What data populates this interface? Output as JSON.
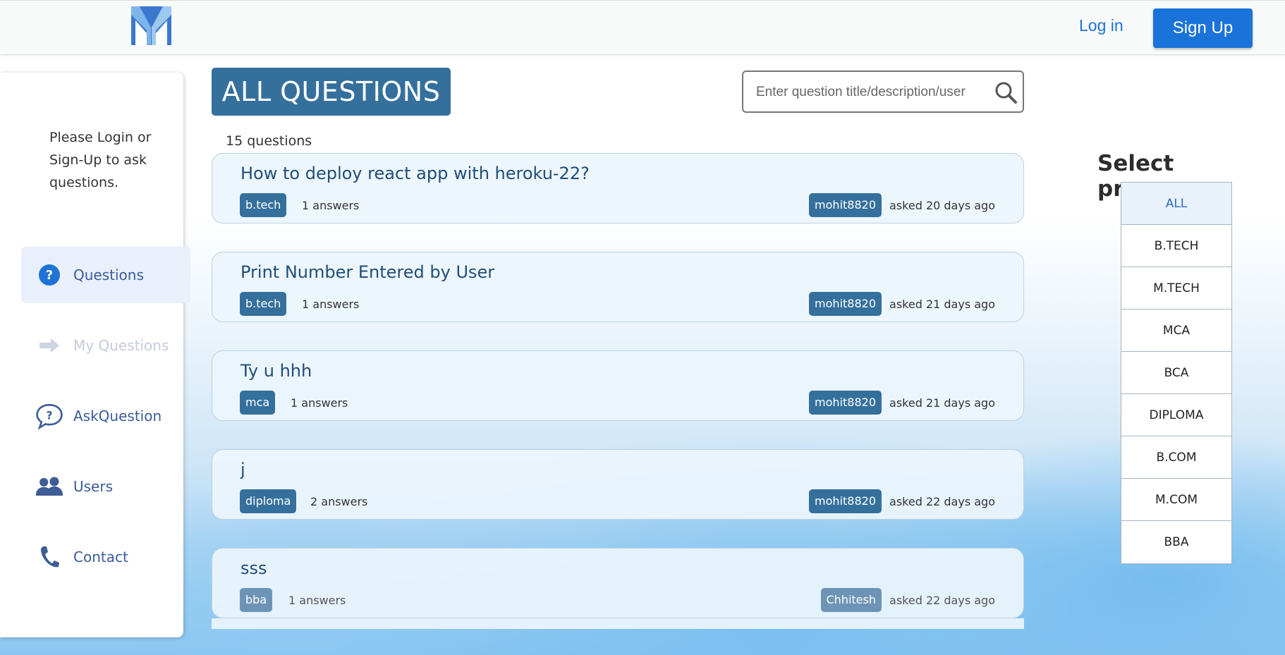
{
  "header": {
    "login_label": "Log in",
    "signup_label": "Sign Up",
    "accent_color": "#1a73d8"
  },
  "sidebar": {
    "message": "Please Login or Sign-Up to ask questions.",
    "items": [
      {
        "label": "Questions",
        "icon": "question-circle-icon",
        "active": true
      },
      {
        "label": "My Questions",
        "icon": "arrow-right-icon",
        "disabled": true
      },
      {
        "label": "AskQuestion",
        "icon": "question-bubble-icon"
      },
      {
        "label": "Users",
        "icon": "users-icon"
      },
      {
        "label": "Contact",
        "icon": "phone-icon"
      }
    ]
  },
  "main": {
    "title": "ALL QUESTIONS",
    "title_color": "#35709d",
    "search_placeholder": "Enter question title/description/user",
    "count_label": "15 questions",
    "questions": [
      {
        "title": "How to deploy react app with heroku-22?",
        "tag": "b.tech",
        "answers": "1 answers",
        "user": "mohit8820",
        "time": "asked 20 days ago"
      },
      {
        "title": "Print Number Entered by User",
        "tag": "b.tech",
        "answers": "1 answers",
        "user": "mohit8820",
        "time": "asked 21 days ago"
      },
      {
        "title": "Ty u hhh",
        "tag": "mca",
        "answers": "1 answers",
        "user": "mohit8820",
        "time": "asked 21 days ago"
      },
      {
        "title": "j",
        "tag": "diploma",
        "answers": "2 answers",
        "user": "mohit8820",
        "time": "asked 22 days ago"
      },
      {
        "title": "sss",
        "tag": "bba",
        "answers": "1 answers",
        "user": "Chhitesh",
        "time": "asked 22 days ago"
      }
    ]
  },
  "programs": {
    "title": "Select program",
    "selected": "ALL",
    "options": [
      "ALL",
      "B.TECH",
      "M.TECH",
      "MCA",
      "BCA",
      "DIPLOMA",
      "B.COM",
      "M.COM",
      "BBA"
    ]
  }
}
